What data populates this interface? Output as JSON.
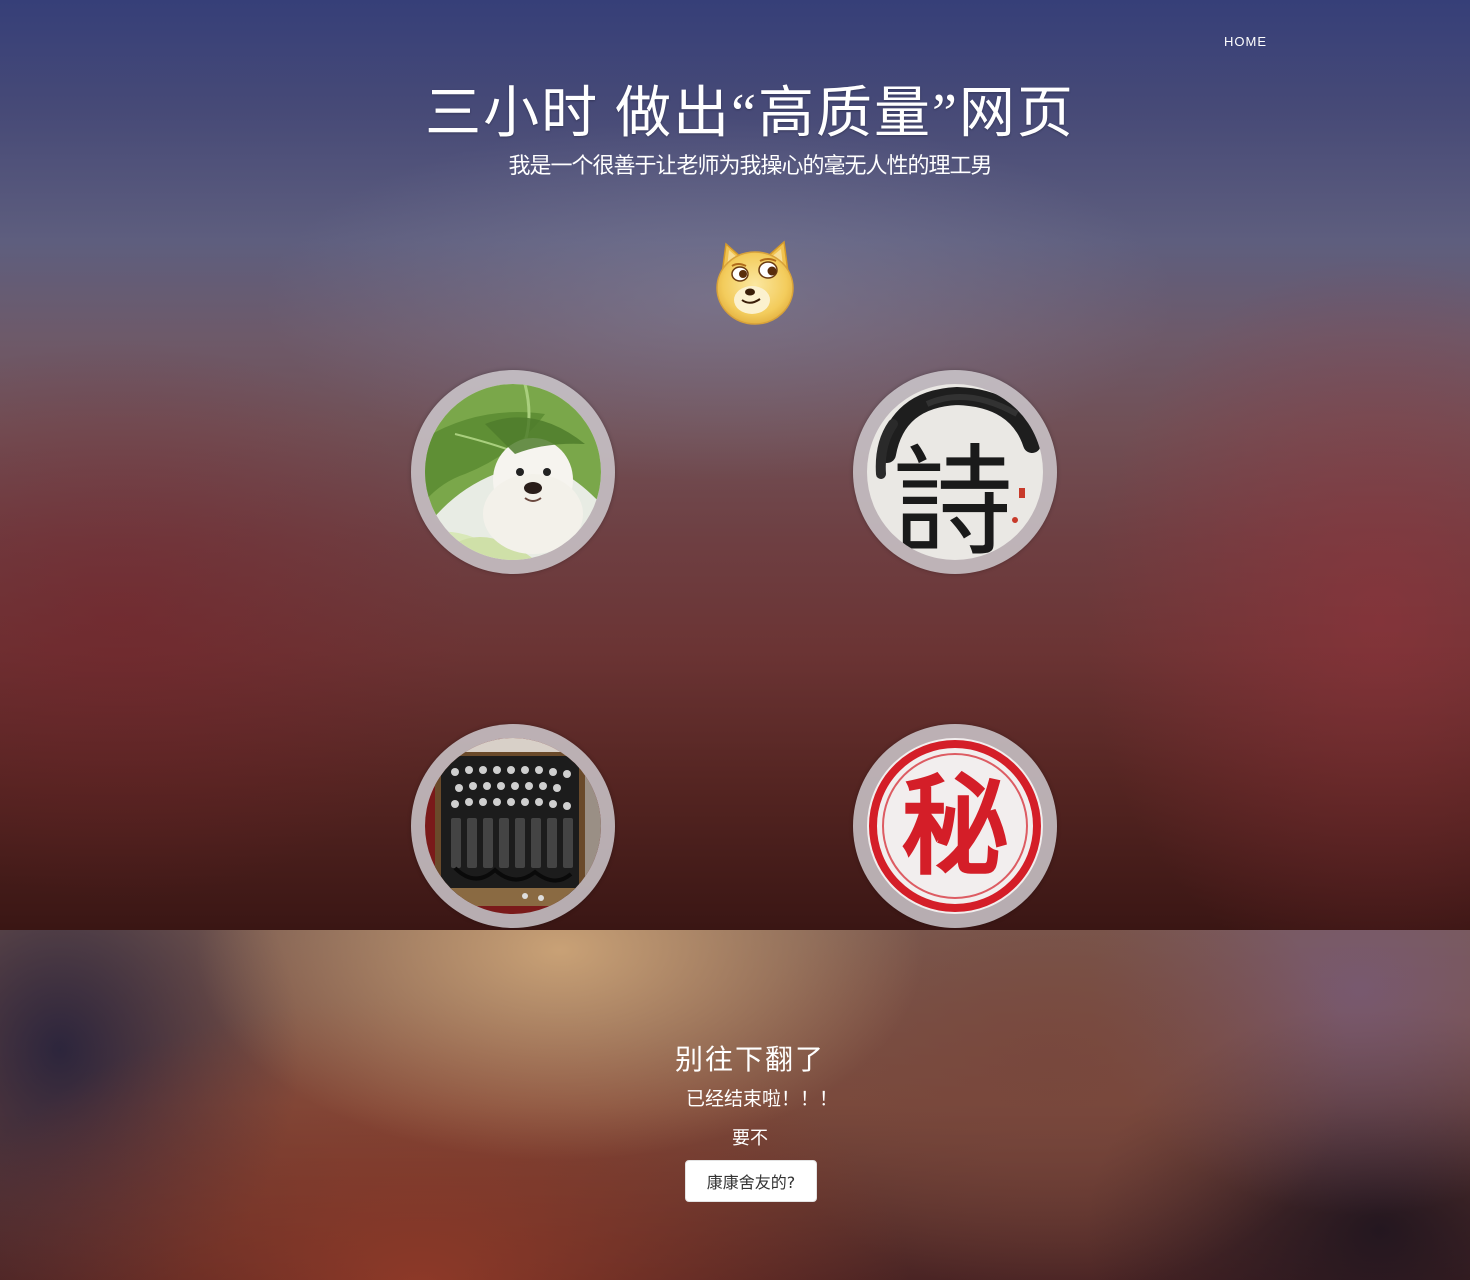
{
  "nav": {
    "home_label": "HOME"
  },
  "hero": {
    "title": "三小时 做出“高质量”网页",
    "subtitle": "我是一个很善于让老师为我操心的毫无人性的理工男"
  },
  "gallery": {
    "items": [
      {
        "name": "dog-leaf-image",
        "seal_text": ""
      },
      {
        "name": "poem-calligraphy-image",
        "seal_text": "詩"
      },
      {
        "name": "enigma-machine-image",
        "seal_text": ""
      },
      {
        "name": "secret-stamp-image",
        "seal_text": "秘"
      }
    ]
  },
  "footer": {
    "heading": "别往下翻了",
    "line1": "已经结束啦！！！",
    "line2": "要不",
    "button_label": "康康舍友的?"
  },
  "colors": {
    "hero_top": "#363f78",
    "hero_bottom": "#3a1614",
    "circle_ring": "#cdc8cd",
    "button_bg": "#ffffff",
    "text": "#ffffff"
  },
  "icons": {
    "mascot": "doge-face-icon"
  }
}
